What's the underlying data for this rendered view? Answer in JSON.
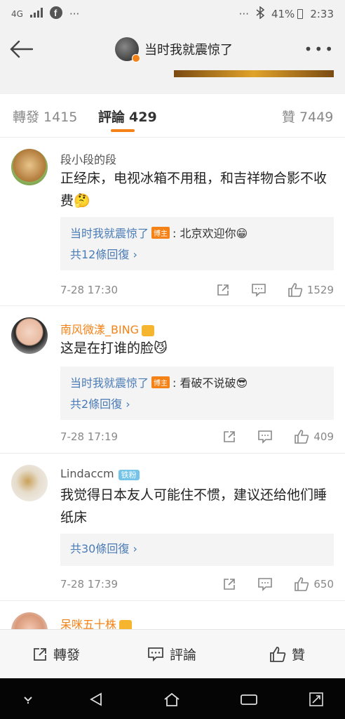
{
  "status": {
    "network": "4G",
    "battery": "41%",
    "time": "2:33"
  },
  "header": {
    "title": "当时我就震惊了"
  },
  "tabs": {
    "repost": {
      "label": "轉發",
      "count": "1415"
    },
    "comment": {
      "label": "評論",
      "count": "429"
    },
    "like": {
      "label": "贊",
      "count": "7449"
    }
  },
  "comments": [
    {
      "name": "段小段的段",
      "text": "正经床，电视冰箱不用租，和吉祥物合影不收费🤔",
      "reply": {
        "name": "当时我就震惊了",
        "badge": "博主",
        "text": ": 北京欢迎你😁"
      },
      "more": "共12條回復 ›",
      "time": "7-28 17:30",
      "likes": "1529"
    },
    {
      "name": "南风微漾_BING",
      "text": "这是在打谁的脸😼",
      "reply": {
        "name": "当时我就震惊了",
        "badge": "博主",
        "text": ": 看破不说破😎"
      },
      "more": "共2條回復 ›",
      "time": "7-28 17:19",
      "likes": "409"
    },
    {
      "name": "Lindaccm",
      "fan_badge": "铁粉",
      "text": "我觉得日本友人可能住不惯，建议还给他们睡纸床",
      "more": "共30條回復 ›",
      "time": "7-28 17:39",
      "likes": "650"
    },
    {
      "name": "呆咪五十株"
    }
  ],
  "bottom": {
    "repost": "轉發",
    "comment": "評論",
    "like": "贊"
  }
}
